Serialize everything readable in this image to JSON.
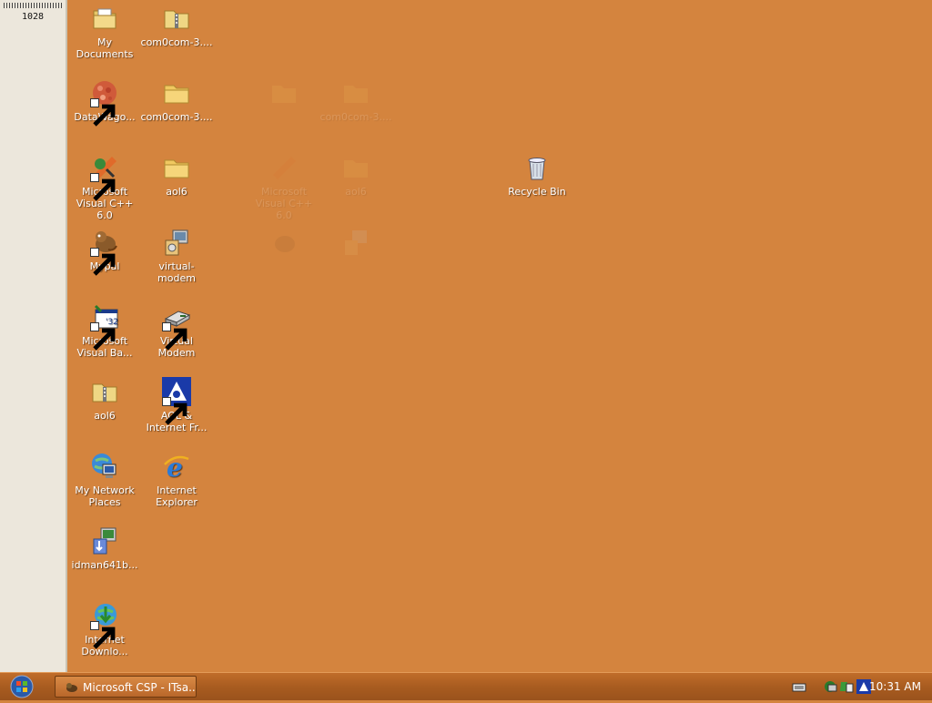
{
  "sidebar": {
    "value": "1028"
  },
  "desktop": {
    "icons": [
      {
        "id": "my-documents",
        "label": "My Documents",
        "icon": "folder-documents-icon"
      },
      {
        "id": "com0com-zip",
        "label": "com0com-3....",
        "icon": "zip-folder-icon"
      },
      {
        "id": "datawagon",
        "label": "DataWago...",
        "icon": "datawagon-icon"
      },
      {
        "id": "com0com-folder",
        "label": "com0com-3....",
        "icon": "folder-icon"
      },
      {
        "id": "visual-cpp",
        "label": "Microsoft Visual C++ 6.0",
        "icon": "visual-cpp-icon"
      },
      {
        "id": "aol6-folder",
        "label": "aol6",
        "icon": "folder-icon"
      },
      {
        "id": "mypal",
        "label": "Mypal",
        "icon": "mypal-icon"
      },
      {
        "id": "virtual-modem-1",
        "label": "virtual-modem",
        "icon": "installer-icon"
      },
      {
        "id": "visual-basic",
        "label": "Microsoft Visual Ba...",
        "icon": "visual-basic-icon"
      },
      {
        "id": "virtual-modem-2",
        "label": "Virtual Modem",
        "icon": "modem-icon"
      },
      {
        "id": "aol6-zip",
        "label": "aol6",
        "icon": "zip-folder-icon"
      },
      {
        "id": "aol-internet",
        "label": "AOL & Internet Fr...",
        "icon": "aol-icon"
      },
      {
        "id": "network-places",
        "label": "My Network Places",
        "icon": "network-icon"
      },
      {
        "id": "ie",
        "label": "Internet Explorer",
        "icon": "internet-explorer-icon"
      },
      {
        "id": "idman",
        "label": "idman641b...",
        "icon": "installer-icon"
      },
      {
        "id": "idm",
        "label": "Internet Downlo...",
        "icon": "download-manager-icon"
      },
      {
        "id": "recycle-bin",
        "label": "Recycle Bin",
        "icon": "recycle-bin-icon"
      }
    ],
    "ghosts": [
      {
        "label": "com0com-3...."
      },
      {
        "label": "Microsoft Visual C++ 6.0"
      },
      {
        "label": "aol6"
      }
    ]
  },
  "taskbar": {
    "task_label": "Microsoft CSP - ITsa...",
    "clock": "10:31 AM"
  },
  "colors": {
    "desktop": "#d4843e",
    "taskbar": "#a95c20"
  }
}
